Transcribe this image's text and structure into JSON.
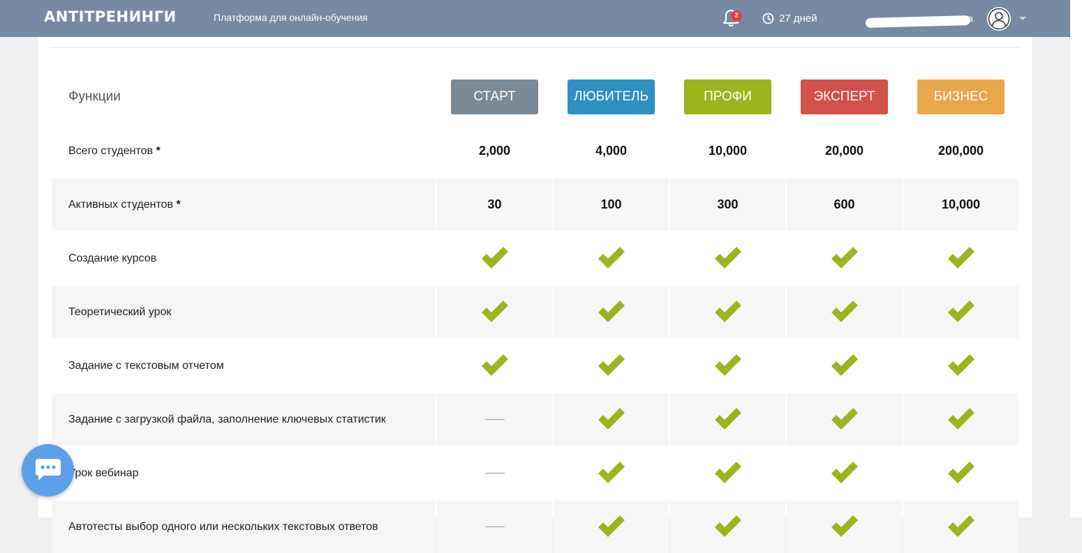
{
  "header": {
    "logo": "ANTITРЕНИНГИ",
    "tagline": "Платформа для онлайн-обучения",
    "notification_count": "2",
    "days_left": "27 дней",
    "user_name_suffix": "а"
  },
  "table": {
    "features_label": "Функции",
    "plans": [
      {
        "name": "СТАРТ",
        "color": "#7a8a96"
      },
      {
        "name": "ЛЮБИТЕЛЬ",
        "color": "#2e8fc0"
      },
      {
        "name": "ПРОФИ",
        "color": "#9cb41e"
      },
      {
        "name": "ЭКСПЕРТ",
        "color": "#d2514a"
      },
      {
        "name": "БИЗНЕС",
        "color": "#e8a74a"
      }
    ],
    "rows": [
      {
        "label": "Всего студентов",
        "star": "*",
        "values": [
          "2,000",
          "4,000",
          "10,000",
          "20,000",
          "200,000"
        ]
      },
      {
        "label": "Активных студентов",
        "star": "*",
        "values": [
          "30",
          "100",
          "300",
          "600",
          "10,000"
        ]
      },
      {
        "label": "Создание курсов",
        "values": [
          "check",
          "check",
          "check",
          "check",
          "check"
        ]
      },
      {
        "label": "Теоретический урок",
        "values": [
          "check",
          "check",
          "check",
          "check",
          "check"
        ]
      },
      {
        "label": "Задание с текстовым отчетом",
        "values": [
          "check",
          "check",
          "check",
          "check",
          "check"
        ]
      },
      {
        "label": "Задание с загрузкой файла, заполнение ключевых статистик",
        "values": [
          "dash",
          "check",
          "check",
          "check",
          "check"
        ]
      },
      {
        "label": "Урок вебинар",
        "values": [
          "dash",
          "check",
          "check",
          "check",
          "check"
        ]
      },
      {
        "label": "Автотесты выбор одного или нескольких текстовых ответов",
        "values": [
          "dash",
          "check",
          "check",
          "check",
          "check"
        ]
      }
    ]
  },
  "colors": {
    "check": "#9cb41e",
    "header_bg": "#768aa3",
    "chat_bg": "#5e9fe9"
  }
}
